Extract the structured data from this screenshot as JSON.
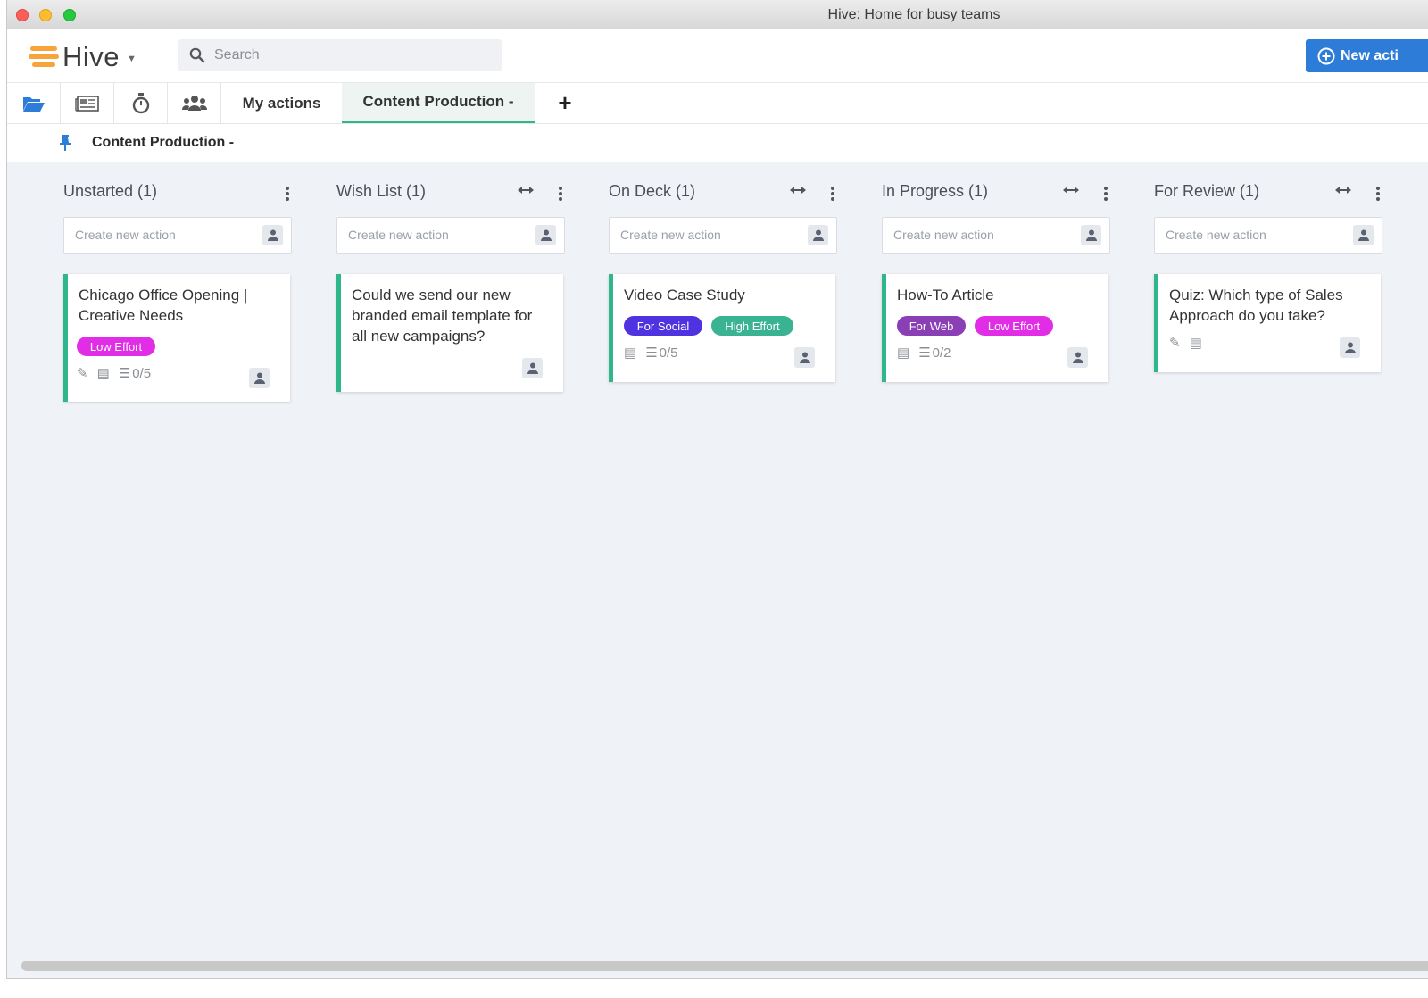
{
  "window": {
    "title": "Hive: Home for busy teams"
  },
  "app": {
    "logo_text": "Hive"
  },
  "search": {
    "placeholder": "Search"
  },
  "new_action_button": {
    "label": "New acti"
  },
  "tabs": {
    "my_actions": "My actions",
    "content_production": "Content Production -",
    "add": "+"
  },
  "breadcrumb": {
    "label": "Content Production -"
  },
  "columns": [
    {
      "title": "Unstarted (1)",
      "new_action_placeholder": "Create new action",
      "card": {
        "title": "Chicago Office Opening | Creative Needs",
        "tags": [
          {
            "label": "Low Effort",
            "color": "#e12ee6"
          }
        ],
        "checklist": "0/5"
      }
    },
    {
      "title": "Wish List (1)",
      "new_action_placeholder": "Create new action",
      "card": {
        "title": "Could we send our new branded email template for all new campaigns?",
        "tags": []
      }
    },
    {
      "title": "On Deck (1)",
      "new_action_placeholder": "Create new action",
      "card": {
        "title": "Video Case Study",
        "tags": [
          {
            "label": "For Social",
            "color": "#4f32e0"
          },
          {
            "label": "High Effort",
            "color": "#3ab393"
          }
        ],
        "checklist": "0/5"
      }
    },
    {
      "title": "In Progress (1)",
      "new_action_placeholder": "Create new action",
      "card": {
        "title": "How-To Article",
        "tags": [
          {
            "label": "For Web",
            "color": "#8a3fb5"
          },
          {
            "label": "Low Effort",
            "color": "#e12ee6"
          }
        ],
        "checklist": "0/2"
      }
    },
    {
      "title": "For Review (1)",
      "new_action_placeholder": "Create new action",
      "card": {
        "title": "Quiz: Which type of Sales Approach do you take?",
        "tags": []
      }
    }
  ],
  "colors": {
    "accent_green": "#2fb68a",
    "primary_blue": "#2d7dd8",
    "logo_orange": "#f7a43a"
  }
}
